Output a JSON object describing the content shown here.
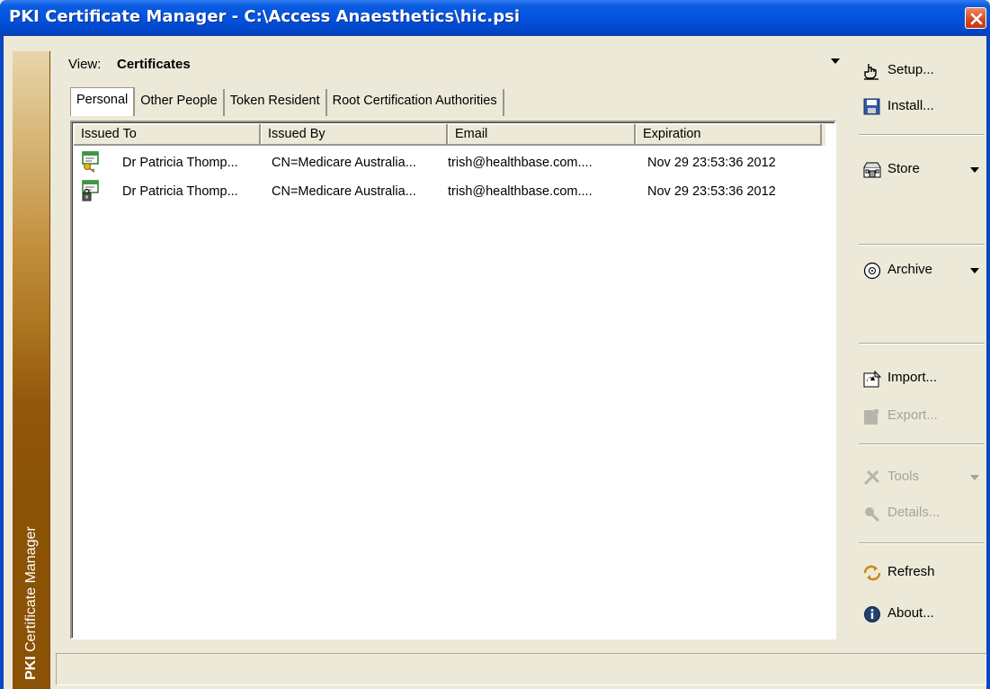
{
  "window": {
    "title": "PKI Certificate Manager - C:\\Access Anaesthetics\\hic.psi",
    "brand_prefix": "PKI",
    "brand_suffix": " Certificate Manager"
  },
  "view": {
    "label": "View:",
    "value": "Certificates"
  },
  "tabs": [
    {
      "label": "Personal",
      "active": true
    },
    {
      "label": "Other People",
      "active": false
    },
    {
      "label": "Token Resident",
      "active": false
    },
    {
      "label": "Root Certification Authorities",
      "active": false
    }
  ],
  "table": {
    "columns": [
      "Issued To",
      "Issued By",
      "Email",
      "Expiration"
    ],
    "rows": [
      {
        "icon": "certificate-key-icon",
        "issued_to": "Dr Patricia Thomp...",
        "issued_by": "CN=Medicare Australia...",
        "email": "trish@healthbase.com....",
        "expiration": "Nov 29 23:53:36 2012"
      },
      {
        "icon": "certificate-lock-icon",
        "issued_to": "Dr Patricia Thomp...",
        "issued_by": "CN=Medicare Australia...",
        "email": "trish@healthbase.com....",
        "expiration": "Nov 29 23:53:36 2012"
      }
    ]
  },
  "sidebar": {
    "setup": "Setup...",
    "install": "Install...",
    "store": "Store",
    "archive": "Archive",
    "import": "Import...",
    "export": "Export...",
    "tools": "Tools",
    "details": "Details...",
    "refresh": "Refresh",
    "about": "About..."
  },
  "colors": {
    "titlebar": "#0353df",
    "window_bg": "#ece9d8",
    "brand_strip": "#8a5205",
    "disabled_text": "#a6a49a"
  }
}
